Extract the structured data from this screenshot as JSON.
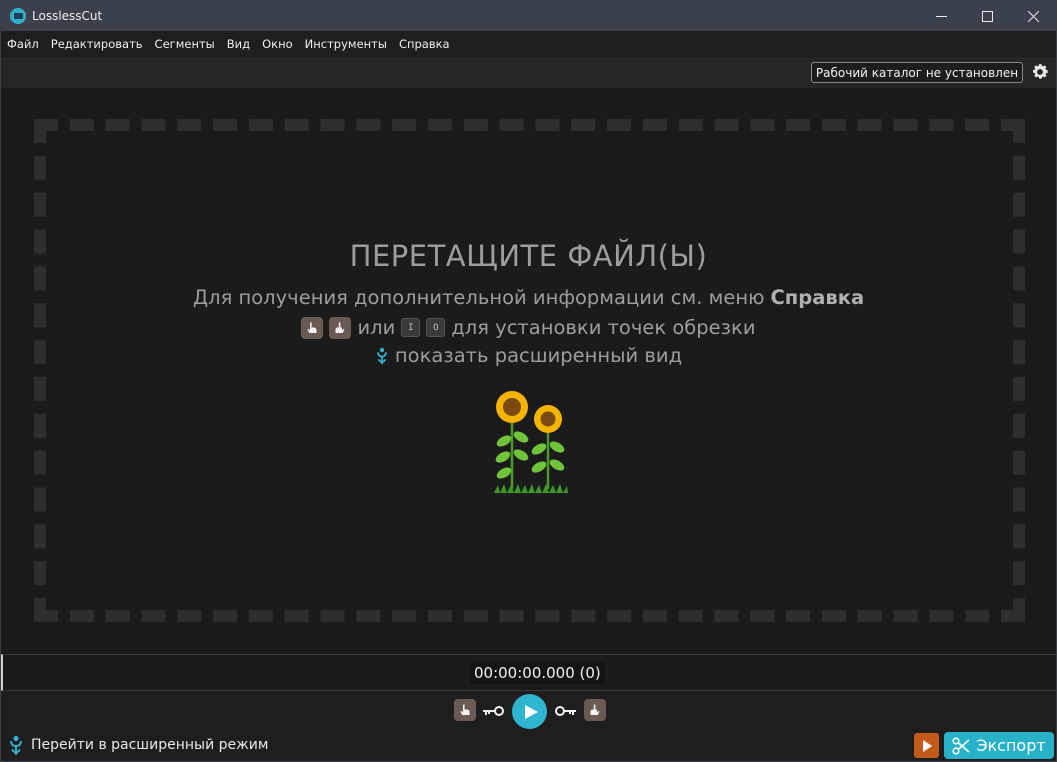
{
  "window": {
    "title": "LosslessCut"
  },
  "menu": [
    "Файл",
    "Редактировать",
    "Сегменты",
    "Вид",
    "Окно",
    "Инструменты",
    "Справка"
  ],
  "topbar": {
    "workdir_label": "Рабочий каталог не установлен"
  },
  "dropzone": {
    "title": "ПЕРЕТАЩИТЕ ФАЙЛ(Ы)",
    "help_prefix": "Для получения дополнительной информации см. меню",
    "help_bold": "Справка",
    "or_text": "или",
    "key_in": "I",
    "key_out": "O",
    "cutpoints_text": "для установки точек обрезки",
    "advanced_view_text": "показать расширенный вид"
  },
  "timeline": {
    "timecode": "00:00:00.000 (0)"
  },
  "bottombar": {
    "advanced_mode_label": "Перейти в расширенный режим",
    "export_label": "Экспорт"
  },
  "colors": {
    "accent": "#27b2c9",
    "export_orange": "#c45a1a",
    "titlebar": "#3a404c"
  },
  "icons": [
    "app-logo-icon",
    "minimize-icon",
    "maximize-icon",
    "close-icon",
    "gear-icon",
    "hand-pointing-icon",
    "key-icon",
    "play-icon",
    "scissors-icon",
    "sunflowers-icon",
    "advanced-mode-icon"
  ]
}
